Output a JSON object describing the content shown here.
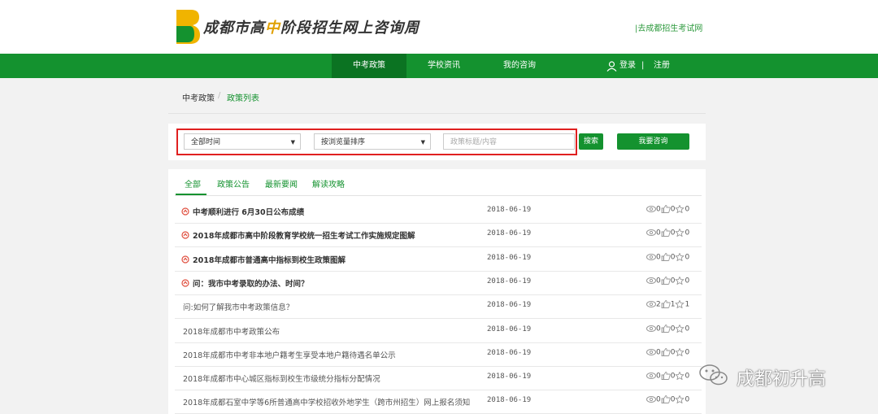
{
  "header": {
    "site_title_part1": "成都市高",
    "site_title_hl": "中",
    "site_title_part2": "阶段招生网上咨询周",
    "ext_link": "|去成都招生考试网"
  },
  "colors": {
    "brand_green": "#14922f",
    "highlight_border": "#e02020",
    "logo_yellow": "#f0b400"
  },
  "nav": {
    "items": [
      {
        "label": "中考政策",
        "active": true
      },
      {
        "label": "学校资讯",
        "active": false
      },
      {
        "label": "我的咨询",
        "active": false
      }
    ],
    "login": "登录",
    "separator": "|",
    "register": "注册"
  },
  "breadcrumb": {
    "root": "中考政策",
    "separator": "/",
    "current": "政策列表"
  },
  "filter": {
    "time_select": "全部时间",
    "sort_select": "按浏览量排序",
    "keyword_placeholder": "政策标题/内容",
    "search_button": "搜索",
    "consult_button": "我要咨询"
  },
  "tabs": [
    {
      "label": "全部",
      "active": true
    },
    {
      "label": "政策公告",
      "active": false
    },
    {
      "label": "最新要闻",
      "active": false
    },
    {
      "label": "解读攻略",
      "active": false
    }
  ],
  "rows": [
    {
      "title": "中考顺利进行 6月30日公布成绩",
      "date": "2018-06-19",
      "views": "0",
      "likes": "0",
      "stars": "0",
      "hot": true
    },
    {
      "title": "2018年成都市高中阶段教育学校统一招生考试工作实施规定图解",
      "date": "2018-06-19",
      "views": "0",
      "likes": "0",
      "stars": "0",
      "hot": true
    },
    {
      "title": "2018年成都市普通高中指标到校生政策图解",
      "date": "2018-06-19",
      "views": "0",
      "likes": "0",
      "stars": "0",
      "hot": true
    },
    {
      "title": "问：我市中考录取的办法、时间？",
      "date": "2018-06-19",
      "views": "0",
      "likes": "0",
      "stars": "0",
      "hot": true
    },
    {
      "title": "问:如何了解我市中考政策信息？",
      "date": "2018-06-19",
      "views": "2",
      "likes": "1",
      "stars": "1",
      "hot": false
    },
    {
      "title": "2018年成都市中考政策公布",
      "date": "2018-06-19",
      "views": "0",
      "likes": "0",
      "stars": "0",
      "hot": false
    },
    {
      "title": "2018年成都市中考非本地户籍考生享受本地户籍待遇名单公示",
      "date": "2018-06-19",
      "views": "0",
      "likes": "0",
      "stars": "0",
      "hot": false
    },
    {
      "title": "2018年成都市中心城区指标到校生市级统分指标分配情况",
      "date": "2018-06-19",
      "views": "0",
      "likes": "0",
      "stars": "0",
      "hot": false
    },
    {
      "title": "2018年成都石室中学等6所普通高中学校招收外地学生（跨市州招生）网上报名须知",
      "date": "2018-06-19",
      "views": "0",
      "likes": "0",
      "stars": "0",
      "hot": false
    }
  ],
  "watermark": {
    "text": "成都初升高"
  }
}
